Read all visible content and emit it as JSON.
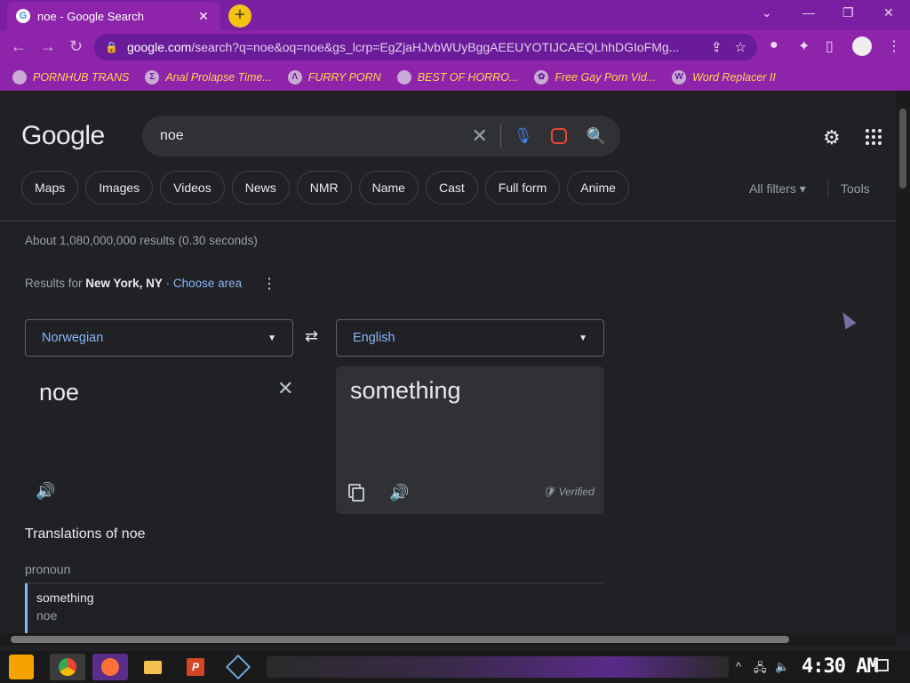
{
  "tab": {
    "title": "noe - Google Search",
    "favicon": "G",
    "close": "✕",
    "new_tab": "+"
  },
  "window": {
    "minimize": "⌄",
    "min": "—",
    "restore": "❐",
    "close": "✕"
  },
  "toolbar": {
    "back": "←",
    "forward": "→",
    "reload": "↻",
    "url_domain": "google.com",
    "url_path": "/search?q=noe&oq=noe&gs_lcrp=EgZjaHJvbWUyBggAEEUYOTIJCAEQLhhDGIoFMg...",
    "share_icon": "share-icon",
    "star_icon": "star-icon"
  },
  "bookmarks": [
    {
      "label": "PORNHUB TRANS",
      "icon": "globe-icon"
    },
    {
      "label": "Anal Prolapse Time...",
      "icon": "sigma-icon"
    },
    {
      "label": "FURRY PORN",
      "icon": "arrow-icon"
    },
    {
      "label": "BEST OF HORRO...",
      "icon": "globe-icon"
    },
    {
      "label": "Free Gay Porn Vid...",
      "icon": "gear-icon"
    },
    {
      "label": "Word Replacer II",
      "icon": "wr-icon"
    }
  ],
  "google": {
    "logo": "Google",
    "query": "noe",
    "chips": [
      "Maps",
      "Images",
      "Videos",
      "News",
      "NMR",
      "Name",
      "Cast",
      "Full form",
      "Anime"
    ],
    "all_filters": "All filters ▾",
    "tools": "Tools",
    "stats": "About 1,080,000,000 results (0.30 seconds)",
    "results_for": "Results for",
    "location": "New York, NY",
    "choose_area": "· Choose area"
  },
  "translate": {
    "source_lang": "Norwegian",
    "target_lang": "English",
    "source_text": "noe",
    "target_text": "something",
    "verified": "Verified",
    "translations_heading": "Translations of noe",
    "pos": "pronoun",
    "entry_word": "something",
    "entry_back": "noe"
  },
  "taskbar": {
    "clock": "4:30 AM"
  }
}
